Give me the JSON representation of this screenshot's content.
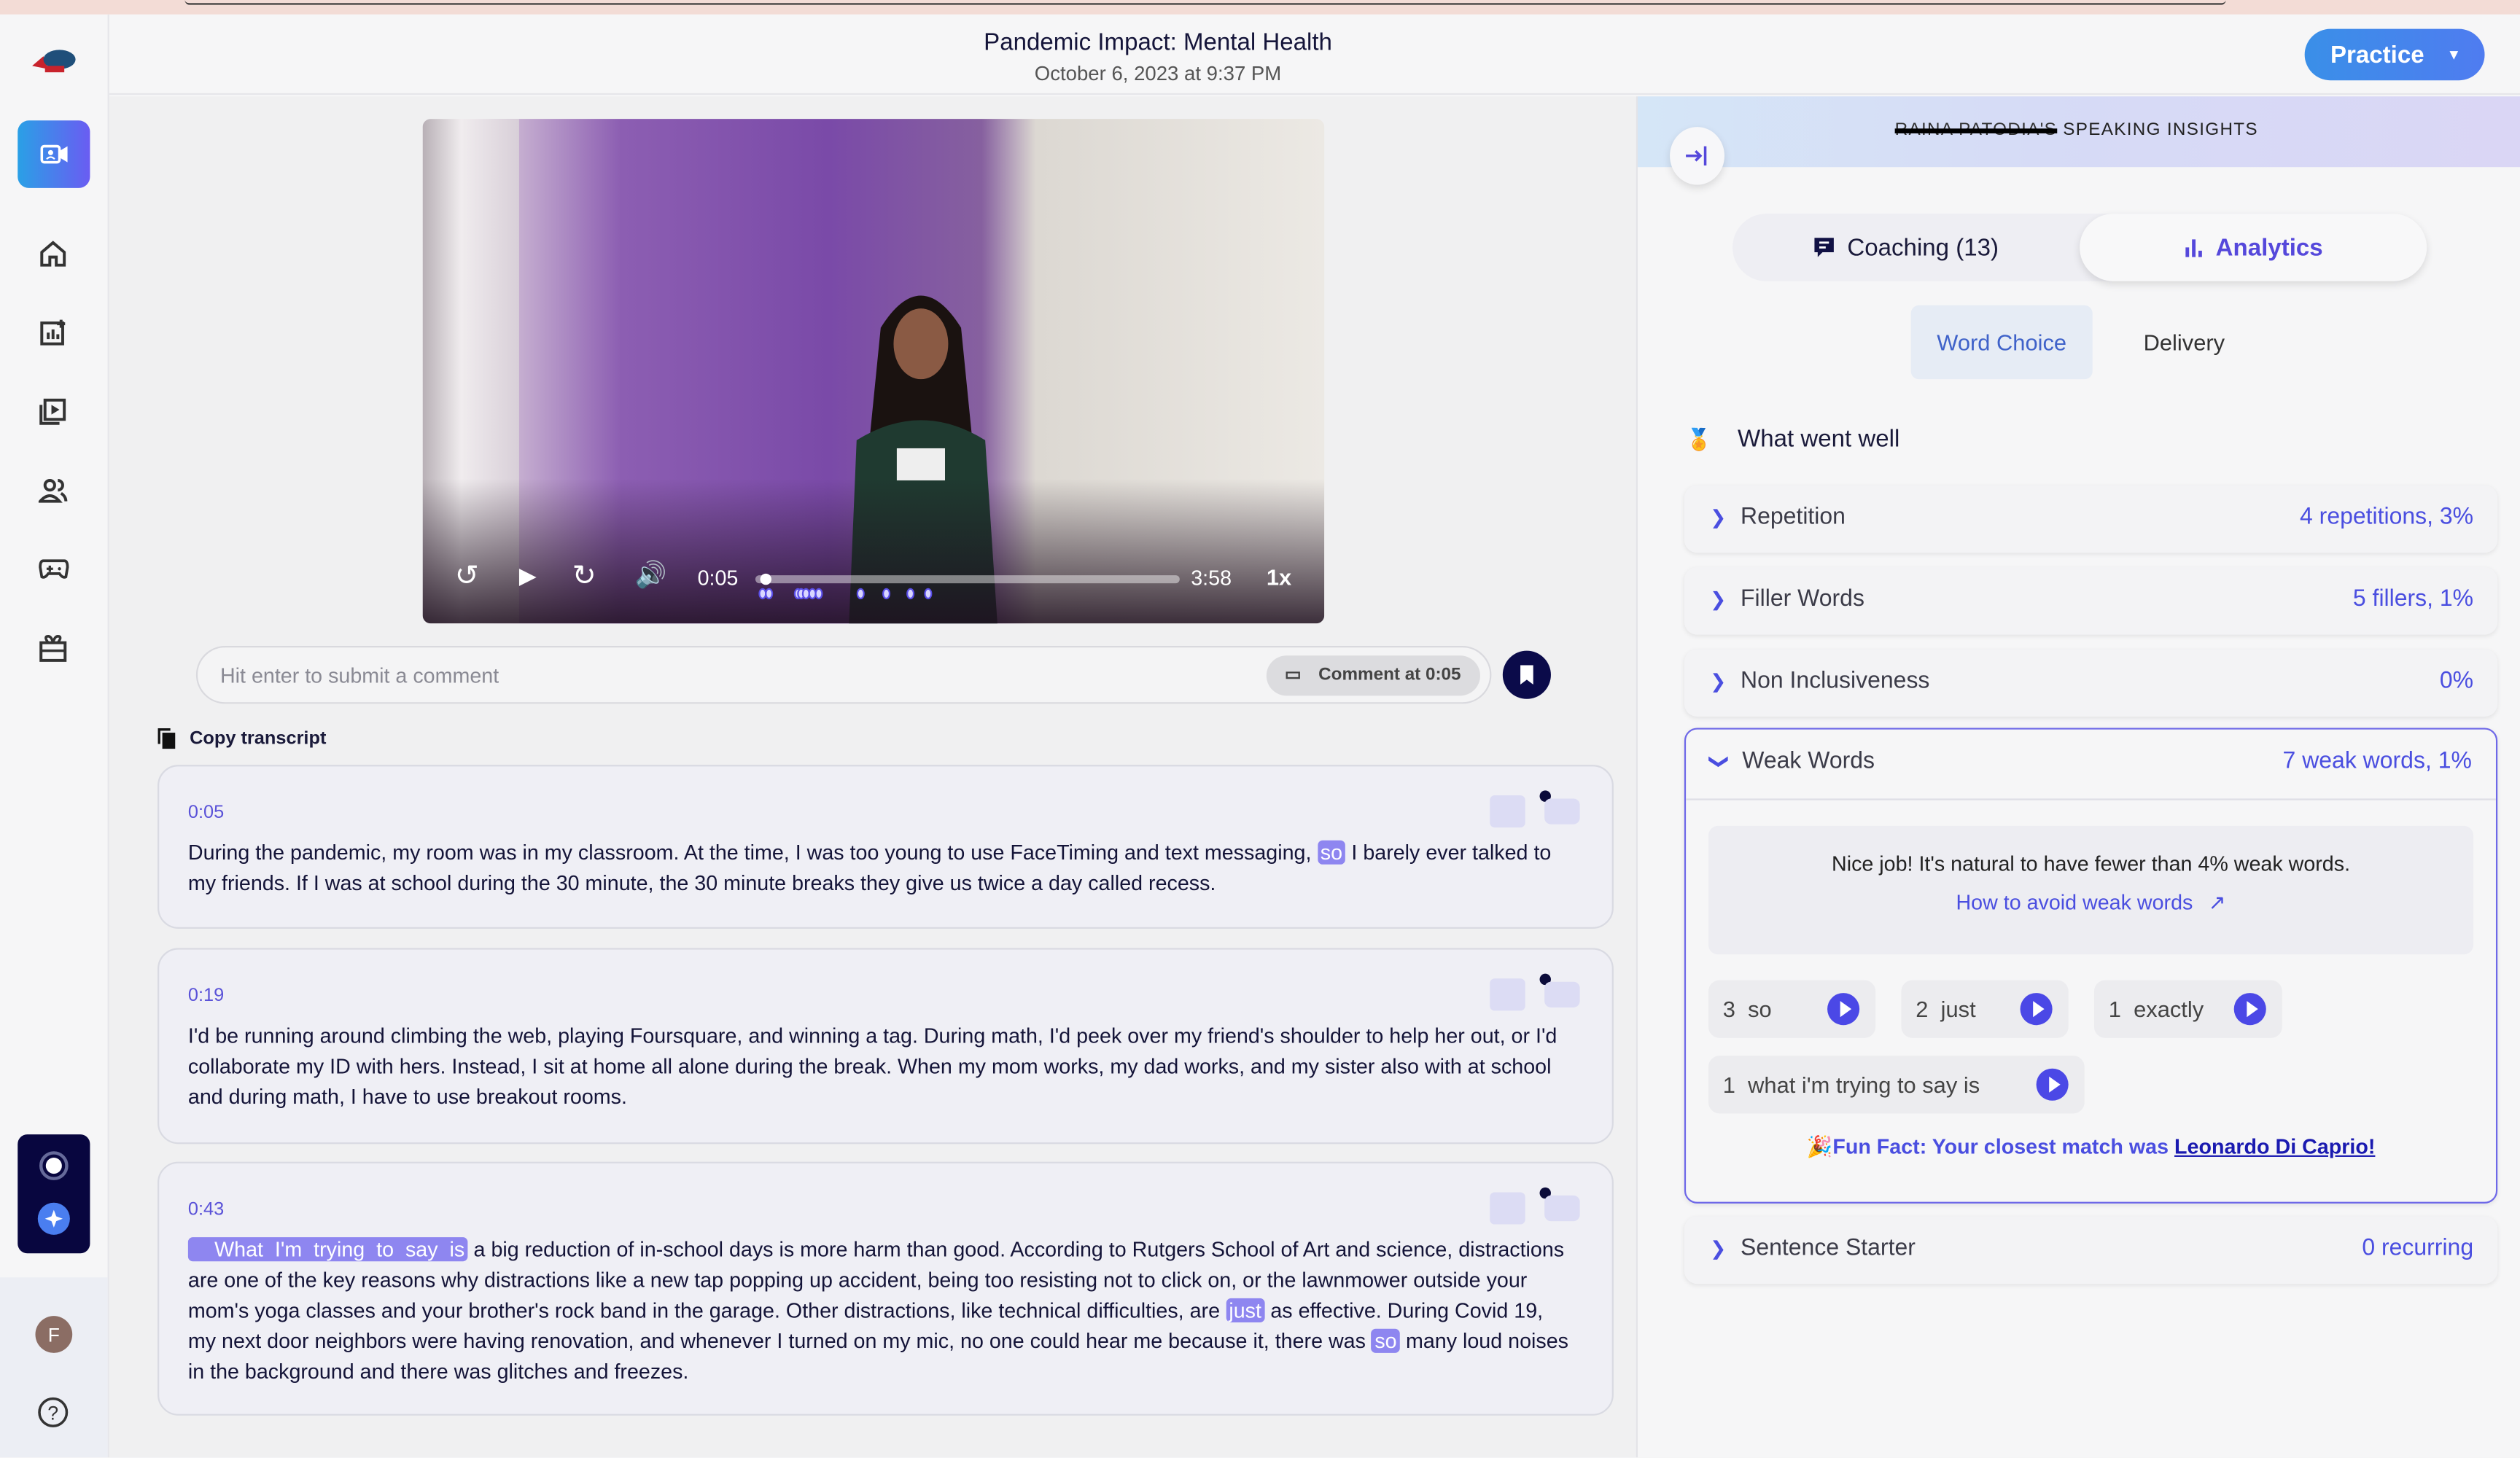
{
  "header": {
    "title": "Pandemic Impact: Mental Health",
    "subtitle": "October 6, 2023 at 9:37 PM",
    "practice_label": "Practice"
  },
  "sidebar": {
    "items": [
      "record-video",
      "home",
      "add-report",
      "video-library",
      "users",
      "games",
      "gifts"
    ],
    "avatar_initial": "F"
  },
  "player": {
    "current_time": "0:05",
    "duration": "3:58",
    "speed": "1x",
    "progress_fraction": 0.021
  },
  "comment": {
    "placeholder": "Hit enter to submit a comment",
    "at_label": "Comment at 0:05"
  },
  "transcript": {
    "copy_label": "Copy transcript",
    "segments": [
      {
        "time": "0:05",
        "parts": [
          {
            "t": "During the pandemic, my room was in my classroom. At the time, I was too young to use FaceTiming and text messaging, "
          },
          {
            "t": "so",
            "hl": true
          },
          {
            "t": " I barely ever talked to my friends. If I was at school during the 30 minute, the 30 minute breaks they give us twice a day called recess."
          }
        ]
      },
      {
        "time": "0:19",
        "parts": [
          {
            "t": "I'd be running around climbing the web, playing Foursquare, and winning a tag. During math, I'd peek over my friend's shoulder to help her out, or I'd collaborate my ID with hers. Instead, I sit at home all alone during the break. When my mom works, my dad works, and my sister also with at school and during math, I have to use breakout rooms."
          }
        ]
      },
      {
        "time": "0:43",
        "parts": [
          {
            "t": "    What  I'm  trying  to  say  is",
            "hl": true
          },
          {
            "t": " a big reduction of in-school days is more harm than good. According to Rutgers School of Art and science, distractions are one of the key reasons why distractions like a new tap popping up accident, being too resisting not to click on, or the lawnmower outside your mom's yoga classes and your brother's rock band in the garage. Other distractions, like technical difficulties, are "
          },
          {
            "t": "just",
            "hl": true
          },
          {
            "t": " as effective. During Covid 19, my next door neighbors were having renovation, and whenever I turned on my mic, no one could hear me because it, there was "
          },
          {
            "t": "so",
            "hl": true
          },
          {
            "t": " many loud noises in the background and there was glitches and freezes."
          }
        ]
      }
    ]
  },
  "insights": {
    "redacted_name": "RAINA PATODIA'S",
    "title": "SPEAKING INSIGHTS",
    "tabs": {
      "coaching": "Coaching (13)",
      "analytics": "Analytics"
    },
    "subtabs": {
      "word_choice": "Word Choice",
      "delivery": "Delivery"
    },
    "went_well": "What went well",
    "rows": [
      {
        "label": "Repetition",
        "value": "4 repetitions, 3%"
      },
      {
        "label": "Filler Words",
        "value": "5 fillers, 1%"
      },
      {
        "label": "Non Inclusiveness",
        "value": "0%"
      },
      {
        "label": "Weak Words",
        "value": "7 weak words, 1%"
      },
      {
        "label": "Sentence Starter",
        "value": "0 recurring"
      }
    ],
    "weak": {
      "tip": "Nice job! It's natural to have fewer than 4% weak words.",
      "link": "How to avoid weak words",
      "chips": [
        {
          "count": "3",
          "word": "so"
        },
        {
          "count": "2",
          "word": "just"
        },
        {
          "count": "1",
          "word": "exactly"
        },
        {
          "count": "1",
          "word": "what i'm trying to say is"
        }
      ],
      "fun_fact": "Fun Fact: Your closest match was ",
      "match": "Leonardo Di Caprio!"
    }
  },
  "colors": {
    "accent": "#5548db",
    "highlight": "#8e86f0",
    "practice": "#3a8fe8"
  }
}
